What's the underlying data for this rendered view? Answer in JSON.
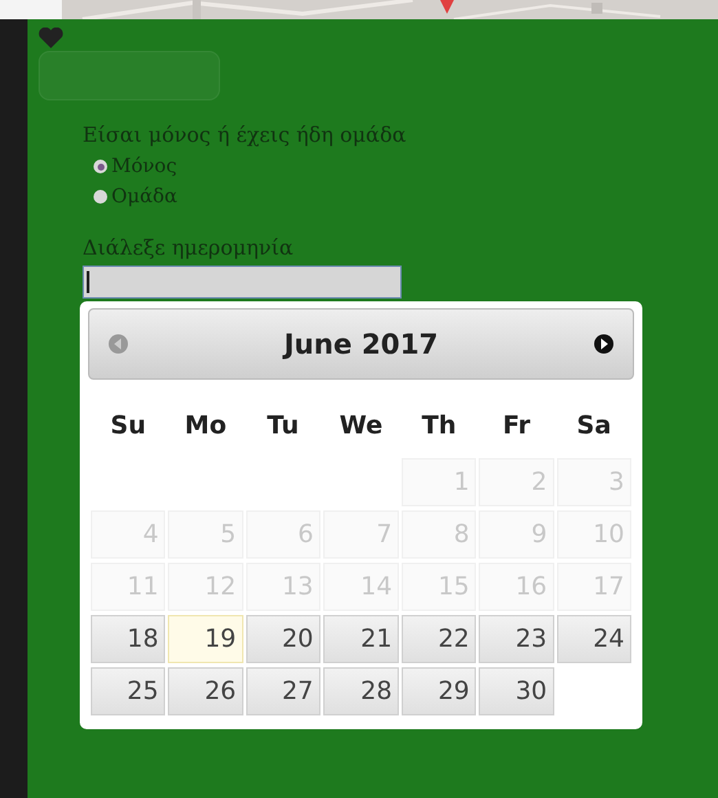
{
  "question": "Είσαι μόνος ή έχεις ήδη ομάδα",
  "options": [
    {
      "label": "Μόνος",
      "selected": true
    },
    {
      "label": "Ομάδα",
      "selected": false
    }
  ],
  "date_label": "Διάλεξε ημερομηνία",
  "date_field": {
    "focused": true
  },
  "calendar": {
    "title": "June 2017",
    "prev_disabled": true,
    "next_disabled": false,
    "weekdays": [
      "Su",
      "Mo",
      "Tu",
      "We",
      "Th",
      "Fr",
      "Sa"
    ],
    "weeks": [
      [
        {
          "day": "1",
          "disabled": true,
          "today": false
        },
        {
          "day": "2",
          "disabled": true,
          "today": false
        },
        {
          "day": "3",
          "disabled": true,
          "today": false
        }
      ],
      [
        {
          "day": "4",
          "disabled": true,
          "today": false
        },
        {
          "day": "5",
          "disabled": true,
          "today": false
        },
        {
          "day": "6",
          "disabled": true,
          "today": false
        },
        {
          "day": "7",
          "disabled": true,
          "today": false
        },
        {
          "day": "8",
          "disabled": true,
          "today": false
        },
        {
          "day": "9",
          "disabled": true,
          "today": false
        },
        {
          "day": "10",
          "disabled": true,
          "today": false
        }
      ],
      [
        {
          "day": "11",
          "disabled": true,
          "today": false
        },
        {
          "day": "12",
          "disabled": true,
          "today": false
        },
        {
          "day": "13",
          "disabled": true,
          "today": false
        },
        {
          "day": "14",
          "disabled": true,
          "today": false
        },
        {
          "day": "15",
          "disabled": true,
          "today": false
        },
        {
          "day": "16",
          "disabled": true,
          "today": false
        },
        {
          "day": "17",
          "disabled": true,
          "today": false
        }
      ],
      [
        {
          "day": "18",
          "disabled": false,
          "today": false
        },
        {
          "day": "19",
          "disabled": false,
          "today": true
        },
        {
          "day": "20",
          "disabled": false,
          "today": false
        },
        {
          "day": "21",
          "disabled": false,
          "today": false
        },
        {
          "day": "22",
          "disabled": false,
          "today": false
        },
        {
          "day": "23",
          "disabled": false,
          "today": false
        },
        {
          "day": "24",
          "disabled": false,
          "today": false
        }
      ],
      [
        {
          "day": "25",
          "disabled": false,
          "today": false
        },
        {
          "day": "26",
          "disabled": false,
          "today": false
        },
        {
          "day": "27",
          "disabled": false,
          "today": false
        },
        {
          "day": "28",
          "disabled": false,
          "today": false
        },
        {
          "day": "29",
          "disabled": false,
          "today": false
        },
        {
          "day": "30",
          "disabled": false,
          "today": false
        }
      ]
    ]
  }
}
